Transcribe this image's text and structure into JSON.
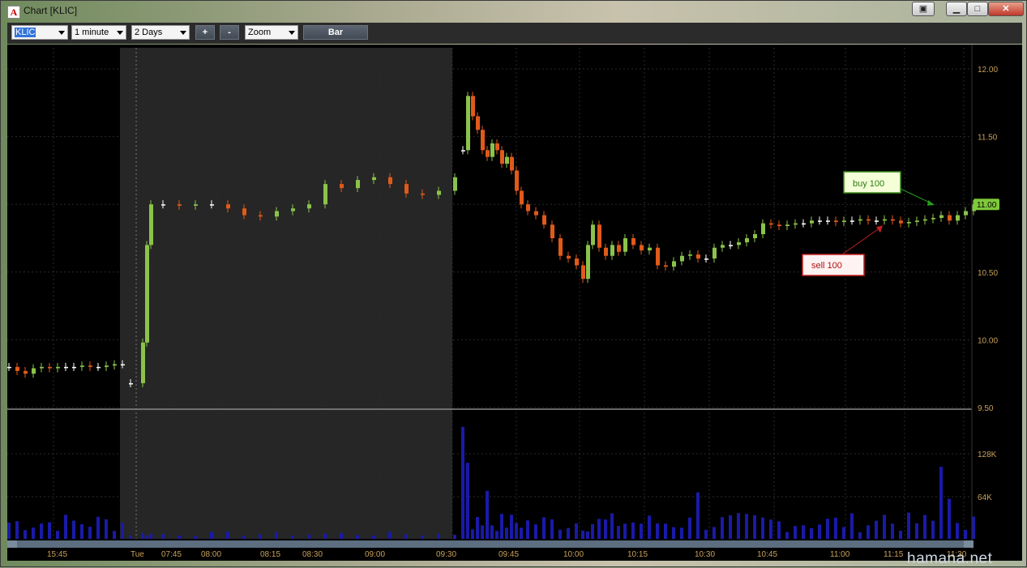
{
  "window": {
    "title": "Chart [KLIC]",
    "app_icon_glyph": "A",
    "controls": [
      "detach-icon",
      "minimize-icon",
      "maximize-icon",
      "close-icon"
    ]
  },
  "toolbar": {
    "symbol": "KLIC",
    "interval": "1 minute",
    "range": "2 Days",
    "zoom_in_label": "+",
    "zoom_out_label": "-",
    "zoom_mode": "Zoom",
    "chart_type_label": "Bar"
  },
  "price_axis": {
    "ticks": [
      "12.00",
      "11.50",
      "11.00",
      "10.50",
      "10.00",
      "9.50"
    ],
    "last_price": "11.00"
  },
  "volume_axis": {
    "ticks": [
      "128K",
      "64K"
    ]
  },
  "time_axis": {
    "labels": [
      "15:45",
      "Tue",
      "07:45",
      "08:00",
      "08:15",
      "08:30",
      "09:00",
      "09:30",
      "09:45",
      "10:00",
      "10:15",
      "10:30",
      "10:45",
      "11:00",
      "11:15",
      "11:30"
    ]
  },
  "annotations": {
    "buy": "buy 100",
    "sell": "sell 100"
  },
  "watermark": "hamana.net",
  "colors": {
    "up": "#8bc34a",
    "down": "#e05a1a",
    "flat": "#ffffff",
    "premarket_shade": "#262626",
    "volume": "#1a1aa8",
    "grid": "#2a2a2a",
    "axis_text": "#c8a15a",
    "last_price_tag": "#7ec83a"
  },
  "chart_data": {
    "type": "candlestick",
    "symbol": "KLIC",
    "interval": "1 minute",
    "y_range": [
      9.5,
      12.1
    ],
    "volume_range": [
      0,
      160000
    ],
    "segments": [
      {
        "session": "prior close",
        "points": [
          [
            0,
            9.8
          ],
          [
            10,
            9.77
          ],
          [
            20,
            9.75
          ],
          [
            30,
            9.79
          ],
          [
            40,
            9.8
          ],
          [
            50,
            9.79
          ],
          [
            60,
            9.8
          ],
          [
            70,
            9.8
          ],
          [
            80,
            9.8
          ],
          [
            90,
            9.81
          ],
          [
            100,
            9.8
          ],
          [
            110,
            9.8
          ],
          [
            120,
            9.81
          ],
          [
            130,
            9.82
          ],
          [
            140,
            9.82
          ]
        ]
      },
      {
        "session": "pre-market",
        "points": [
          [
            150,
            9.68
          ],
          [
            165,
            9.98
          ],
          [
            170,
            10.7
          ],
          [
            175,
            11.0
          ],
          [
            190,
            11.0
          ],
          [
            210,
            10.99
          ],
          [
            230,
            11.0
          ],
          [
            250,
            11.0
          ],
          [
            270,
            10.97
          ],
          [
            290,
            10.92
          ],
          [
            310,
            10.91
          ],
          [
            330,
            10.95
          ],
          [
            350,
            10.97
          ],
          [
            370,
            11.0
          ],
          [
            390,
            11.15
          ],
          [
            410,
            11.12
          ],
          [
            430,
            11.18
          ],
          [
            450,
            11.2
          ],
          [
            470,
            11.15
          ],
          [
            490,
            11.08
          ],
          [
            510,
            11.07
          ],
          [
            530,
            11.1
          ],
          [
            550,
            11.2
          ]
        ]
      },
      {
        "session": "regular",
        "points": [
          [
            560,
            11.4
          ],
          [
            566,
            11.8
          ],
          [
            572,
            11.65
          ],
          [
            578,
            11.55
          ],
          [
            584,
            11.4
          ],
          [
            590,
            11.35
          ],
          [
            596,
            11.45
          ],
          [
            602,
            11.4
          ],
          [
            608,
            11.3
          ],
          [
            614,
            11.35
          ],
          [
            620,
            11.25
          ],
          [
            626,
            11.1
          ],
          [
            632,
            11.0
          ],
          [
            640,
            10.95
          ],
          [
            650,
            10.92
          ],
          [
            660,
            10.85
          ],
          [
            670,
            10.75
          ],
          [
            680,
            10.62
          ],
          [
            690,
            10.6
          ],
          [
            700,
            10.55
          ],
          [
            708,
            10.45
          ],
          [
            714,
            10.7
          ],
          [
            720,
            10.85
          ],
          [
            728,
            10.68
          ],
          [
            736,
            10.62
          ],
          [
            744,
            10.7
          ],
          [
            752,
            10.65
          ],
          [
            760,
            10.75
          ],
          [
            770,
            10.7
          ],
          [
            780,
            10.66
          ],
          [
            790,
            10.68
          ],
          [
            800,
            10.55
          ],
          [
            810,
            10.54
          ],
          [
            820,
            10.58
          ],
          [
            830,
            10.62
          ],
          [
            840,
            10.63
          ],
          [
            850,
            10.6
          ],
          [
            860,
            10.6
          ],
          [
            870,
            10.68
          ],
          [
            880,
            10.7
          ],
          [
            890,
            10.7
          ],
          [
            900,
            10.72
          ],
          [
            910,
            10.75
          ],
          [
            920,
            10.78
          ],
          [
            930,
            10.86
          ],
          [
            940,
            10.85
          ],
          [
            950,
            10.84
          ],
          [
            960,
            10.85
          ],
          [
            970,
            10.86
          ],
          [
            980,
            10.86
          ],
          [
            990,
            10.88
          ],
          [
            1000,
            10.88
          ],
          [
            1010,
            10.88
          ],
          [
            1020,
            10.87
          ],
          [
            1030,
            10.88
          ],
          [
            1040,
            10.88
          ],
          [
            1050,
            10.89
          ],
          [
            1060,
            10.88
          ],
          [
            1070,
            10.88
          ],
          [
            1080,
            10.89
          ],
          [
            1090,
            10.88
          ],
          [
            1100,
            10.86
          ],
          [
            1110,
            10.87
          ],
          [
            1120,
            10.88
          ],
          [
            1130,
            10.89
          ],
          [
            1140,
            10.9
          ],
          [
            1150,
            10.92
          ],
          [
            1160,
            10.88
          ],
          [
            1170,
            10.92
          ],
          [
            1180,
            10.95
          ],
          [
            1190,
            11.0
          ]
        ]
      }
    ],
    "volume_spikes": [
      [
        560,
        140000
      ],
      [
        566,
        95000
      ],
      [
        590,
        60000
      ],
      [
        600,
        58000
      ],
      [
        710,
        100000
      ],
      [
        740,
        70000
      ],
      [
        850,
        58000
      ],
      [
        1080,
        30000
      ],
      [
        1150,
        90000
      ],
      [
        1160,
        50000
      ]
    ],
    "annotations": [
      {
        "label": "buy 100",
        "side": "buy",
        "x": 1150,
        "price": 10.99
      },
      {
        "label": "sell 100",
        "side": "sell",
        "x": 1090,
        "price": 10.88
      }
    ]
  }
}
